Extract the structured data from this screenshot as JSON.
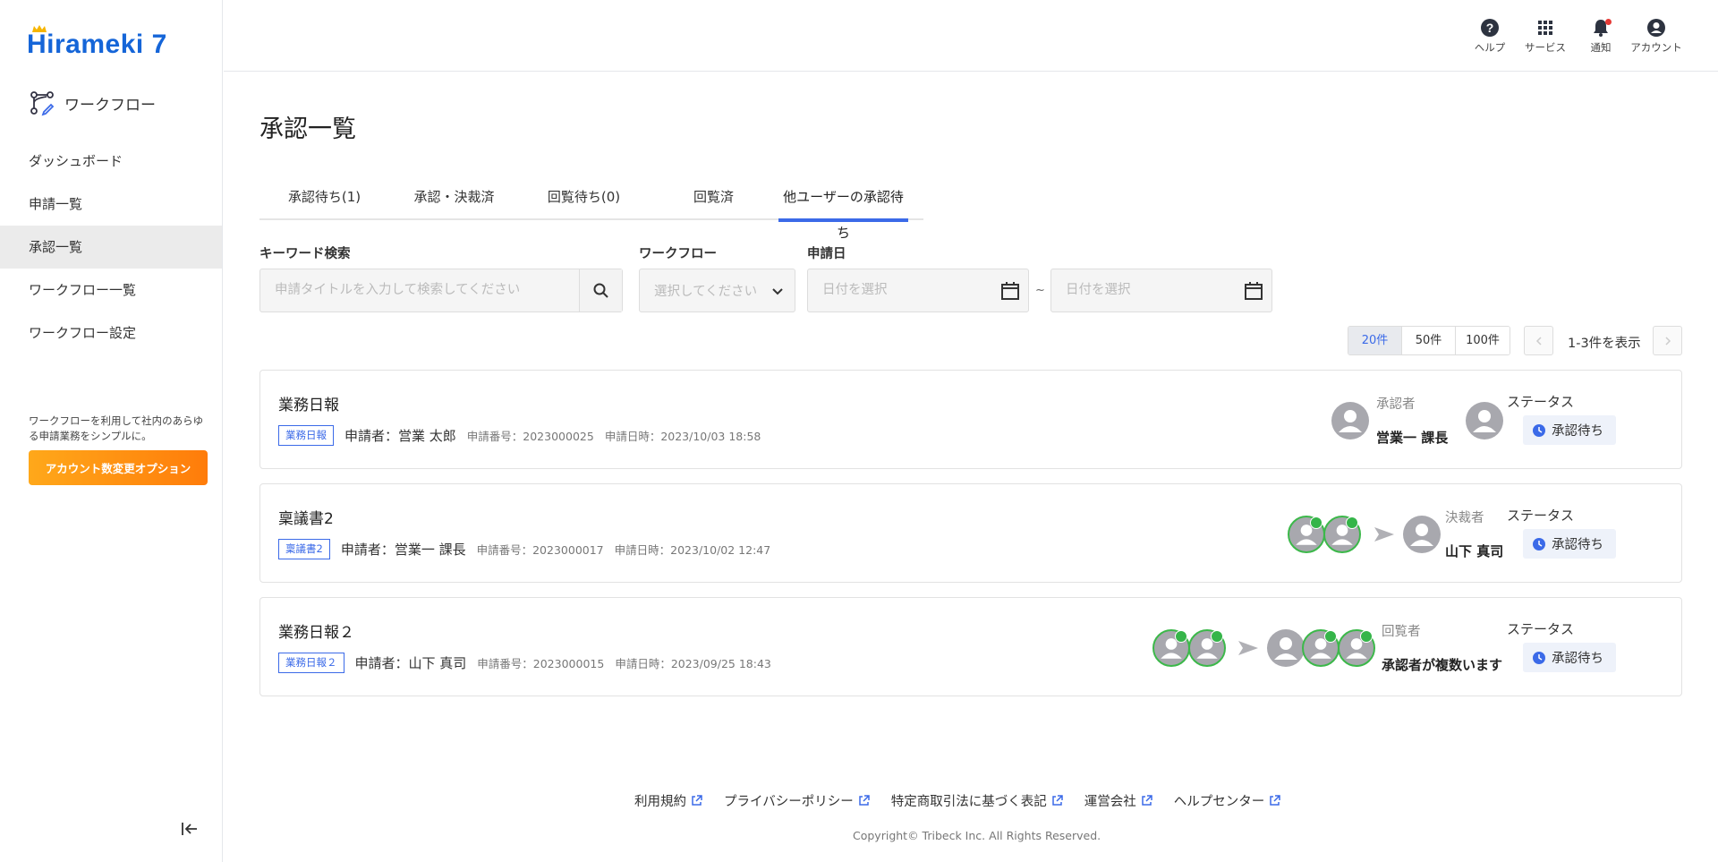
{
  "brand": {
    "logo_text": "Hirameki 7",
    "accent": "#3b6ae8",
    "logo_color": "#1565d8"
  },
  "sidebar": {
    "app_name": "ワークフロー",
    "items": [
      {
        "label": "ダッシュボード"
      },
      {
        "label": "申請一覧"
      },
      {
        "label": "承認一覧",
        "active": true
      },
      {
        "label": "ワークフロー一覧"
      },
      {
        "label": "ワークフロー設定"
      }
    ],
    "note": "ワークフローを利用して社内のあらゆる申請業務をシンプルに。",
    "promo_button": "アカウント数変更オプション"
  },
  "header": {
    "icons": [
      {
        "label": "ヘルプ",
        "icon": "help-icon"
      },
      {
        "label": "サービス",
        "icon": "grid-icon"
      },
      {
        "label": "通知",
        "icon": "bell-icon"
      },
      {
        "label": "アカウント",
        "icon": "account-icon"
      }
    ]
  },
  "main": {
    "title": "承認一覧",
    "tabs": [
      {
        "label": "承認待ち(1)"
      },
      {
        "label": "承認・決裁済"
      },
      {
        "label": "回覧待ち(0)"
      },
      {
        "label": "回覧済"
      },
      {
        "label": "他ユーザーの承認待ち",
        "active": true
      }
    ],
    "filters": {
      "keyword_label": "キーワード検索",
      "keyword_placeholder": "申請タイトルを入力して検索してください",
      "workflow_label": "ワークフロー",
      "workflow_placeholder": "選択してください",
      "date_label": "申請日",
      "date_from_placeholder": "日付を選択",
      "date_to_placeholder": "日付を選択",
      "date_separator": "~"
    },
    "pagination": {
      "per_page_options": [
        "20件",
        "50件",
        "100件"
      ],
      "selected": "20件",
      "info": "1-3件を表示"
    },
    "cards": [
      {
        "title": "業務日報",
        "tag": "業務日報",
        "applicant": "申請者：営業 太郎",
        "number": "申請番号：2023000025",
        "datetime": "申請日時：2023/10/03 18:58",
        "role_label": "承認者",
        "role_value": "営業一 課長",
        "status_label": "ステータス",
        "status": "承認待ち"
      },
      {
        "title": "稟議書2",
        "tag": "稟議書2",
        "applicant": "申請者：営業一 課長",
        "number": "申請番号：2023000017",
        "datetime": "申請日時：2023/10/02 12:47",
        "role_label": "決裁者",
        "role_value": "山下 真司",
        "status_label": "ステータス",
        "status": "承認待ち"
      },
      {
        "title": "業務日報２",
        "tag": "業務日報２",
        "applicant": "申請者：山下 真司",
        "number": "申請番号：2023000015",
        "datetime": "申請日時：2023/09/25 18:43",
        "role_label": "回覧者",
        "role_value": "承認者が複数います",
        "status_label": "ステータス",
        "status": "承認待ち"
      }
    ]
  },
  "footer": {
    "links": [
      "利用規約",
      "プライバシーポリシー",
      "特定商取引法に基づく表記",
      "運営会社",
      "ヘルプセンター"
    ],
    "copyright": "Copyright© Tribeck Inc. All Rights Reserved."
  }
}
